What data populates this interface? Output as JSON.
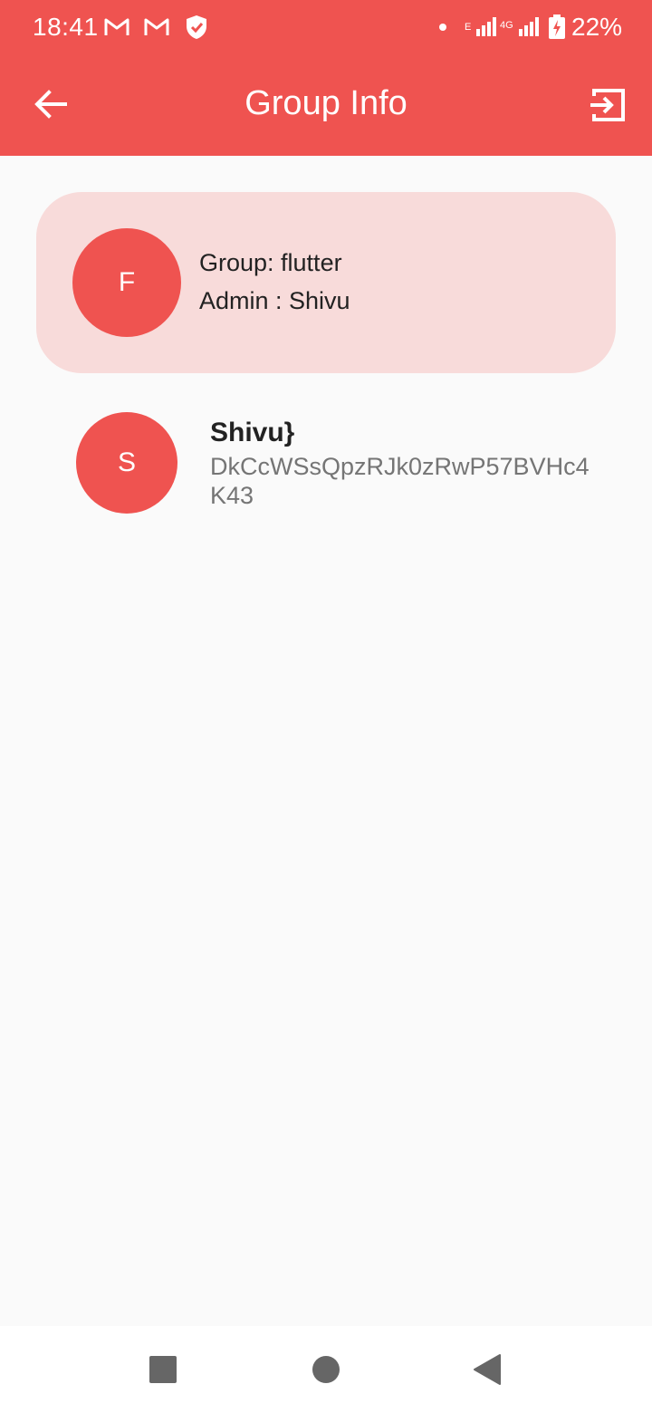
{
  "status_bar": {
    "time": "18:41",
    "icons": [
      "gmail-icon",
      "gmail-icon",
      "shield-icon",
      "dot-icon",
      "signal-icon",
      "signal-icon",
      "battery-charging-icon"
    ],
    "network_e": "E",
    "network_4g": "4G",
    "battery": "22%"
  },
  "app_bar": {
    "title": "Group Info",
    "back_icon": "arrow-back-icon",
    "exit_icon": "exit-to-app-icon"
  },
  "group": {
    "avatar_letter": "F",
    "name": "Group: flutter",
    "admin": "Admin : Shivu"
  },
  "members": [
    {
      "avatar_letter": "S",
      "name": "Shivu}",
      "id": "DkCcWSsQpzRJk0zRwP57BVHc4K43"
    }
  ],
  "colors": {
    "primary": "#ef5350",
    "card_background": "#f8dbda",
    "page_background": "#fafafa"
  }
}
